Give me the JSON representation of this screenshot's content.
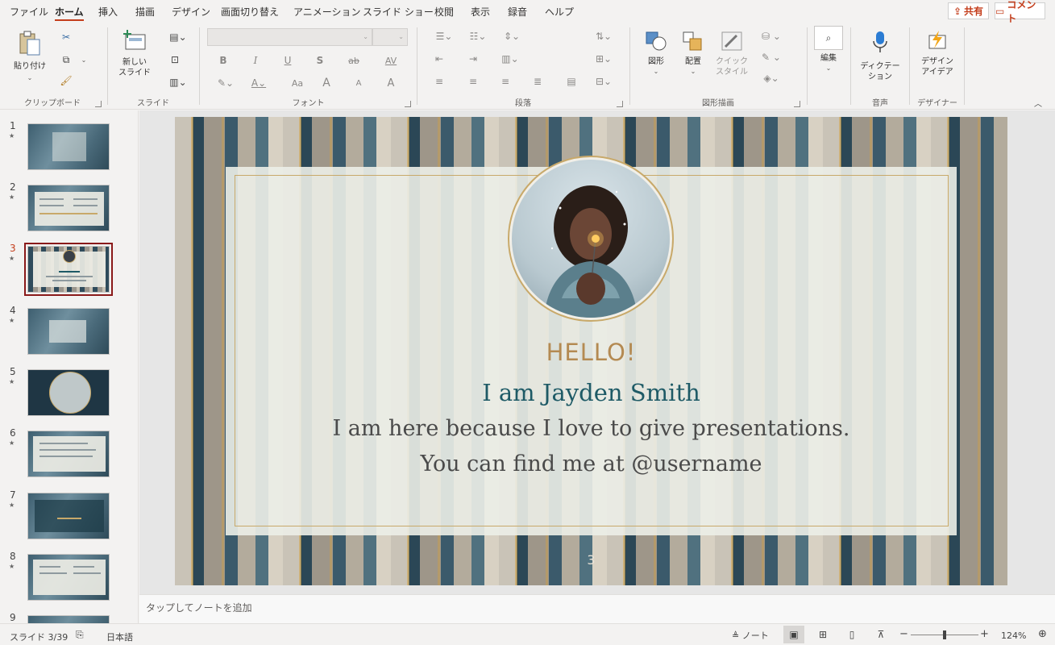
{
  "menu": {
    "tabs": [
      "ファイル",
      "ホーム",
      "挿入",
      "描画",
      "デザイン",
      "画面切り替え",
      "アニメーション",
      "スライド ショー",
      "校閲",
      "表示",
      "録音",
      "ヘルプ"
    ],
    "active_index": 1,
    "share_label": "共有",
    "comment_label": "コメント"
  },
  "ribbon": {
    "clipboard": {
      "paste_label": "貼り付け",
      "group_label": "クリップボード"
    },
    "slides": {
      "new_slide_label_1": "新しい",
      "new_slide_label_2": "スライド",
      "group_label": "スライド"
    },
    "font": {
      "group_label": "フォント",
      "bold": "B",
      "italic": "I",
      "underline": "U",
      "shadow": "S",
      "strike": "ab",
      "spacing": "AV",
      "case": "Aa",
      "grow": "A",
      "shrink": "A",
      "clear": "A"
    },
    "paragraph": {
      "group_label": "段落"
    },
    "drawing": {
      "shapes_label": "図形",
      "arrange_label": "配置",
      "quick_style_1": "クイック",
      "quick_style_2": "スタイル",
      "group_label": "図形描画"
    },
    "editing": {
      "label": "編集"
    },
    "voice": {
      "dictate_1": "ディクテー",
      "dictate_2": "ション",
      "group_label": "音声"
    },
    "designer": {
      "label_1": "デザイン",
      "label_2": "アイデア",
      "group_label": "デザイナー"
    }
  },
  "thumbnails": [
    {
      "num": "1",
      "star": "★"
    },
    {
      "num": "2",
      "star": "★"
    },
    {
      "num": "3",
      "star": "★"
    },
    {
      "num": "4",
      "star": "★"
    },
    {
      "num": "5",
      "star": "★"
    },
    {
      "num": "6",
      "star": "★"
    },
    {
      "num": "7",
      "star": "★"
    },
    {
      "num": "8",
      "star": "★"
    },
    {
      "num": "9",
      "star": ""
    }
  ],
  "selected_slide": 3,
  "slide": {
    "hello": "HELLO!",
    "name": "I am Jayden Smith",
    "line1": "I am here because I love to give presentations.",
    "line2": "You can find me at @username",
    "page_number": "3"
  },
  "notes_placeholder": "タップしてノートを追加",
  "status": {
    "slide_info": "スライド 3/39",
    "language": "日本語",
    "notes_label": "ノート",
    "zoom": "124%"
  },
  "colors": {
    "accent": "#c43e1c",
    "selection": "#8a1a1a",
    "gold": "#b48a52",
    "teal_text": "#1e5a66"
  }
}
